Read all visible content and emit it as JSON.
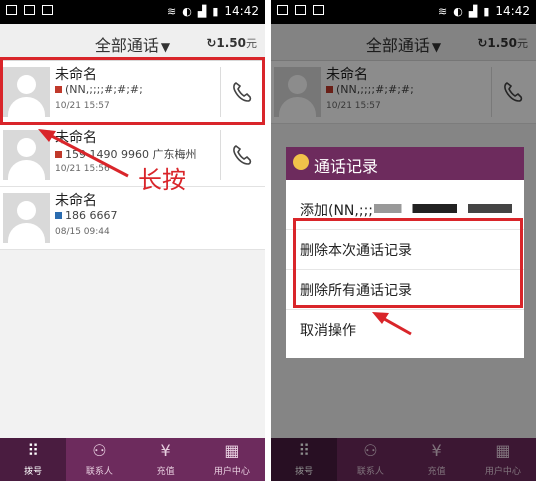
{
  "status": {
    "time": "14:42"
  },
  "header": {
    "title": "全部通话",
    "balance": "1.50",
    "balance_unit": "元"
  },
  "calls": [
    {
      "name": "未命名",
      "number": "(NN,;;;;#;#;#;",
      "date": "10/21  15:57"
    },
    {
      "name": "未命名",
      "number": "159 1490 9960  广东梅州",
      "date": "10/21  15:56"
    },
    {
      "name": "未命名",
      "number": "186 6667",
      "date": "08/15  09:44"
    }
  ],
  "annotation": {
    "left_text": "长按"
  },
  "tabs": [
    {
      "label": "拨号"
    },
    {
      "label": "联系人"
    },
    {
      "label": "充值"
    },
    {
      "label": "用户中心"
    }
  ],
  "dialog": {
    "title": "通话记录",
    "items": [
      {
        "label": "添加(NN,;;;"
      },
      {
        "label": "删除本次通话记录"
      },
      {
        "label": "删除所有通话记录"
      },
      {
        "label": "取消操作"
      }
    ]
  },
  "colors": {
    "brand": "#6d2b5d",
    "annotation": "#d9252a"
  }
}
